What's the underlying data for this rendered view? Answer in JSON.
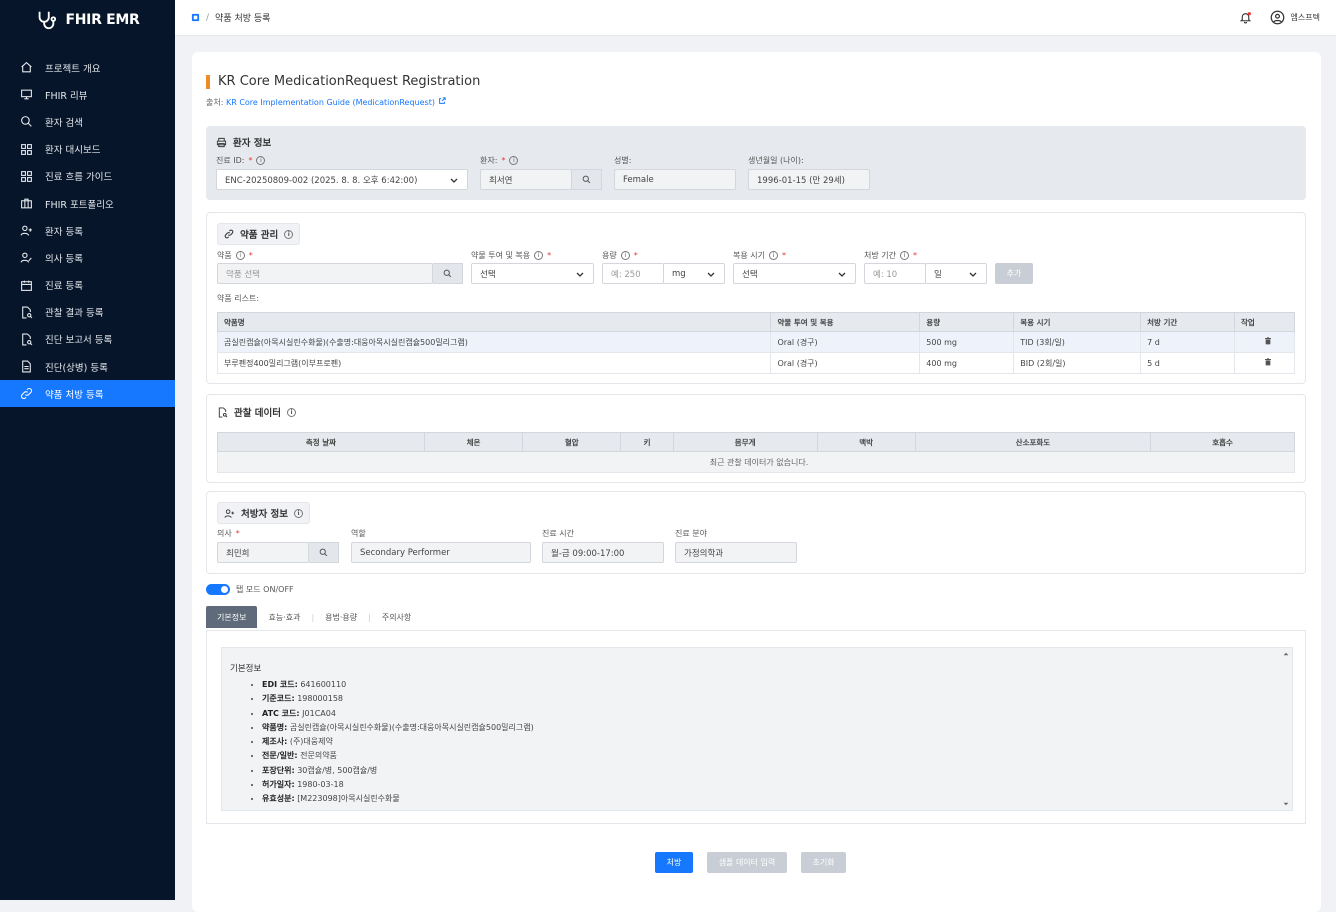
{
  "app": {
    "name": "FHIR EMR"
  },
  "sidebar": {
    "items": [
      {
        "label": "프로젝트 개요",
        "icon": "home-icon"
      },
      {
        "label": "FHIR 리뷰",
        "icon": "presentation-icon"
      },
      {
        "label": "환자 검색",
        "icon": "search-icon"
      },
      {
        "label": "환자 대시보드",
        "icon": "dashboard-icon"
      },
      {
        "label": "진료 흐름 가이드",
        "icon": "dashboard-icon"
      },
      {
        "label": "FHIR 포트폴리오",
        "icon": "portfolio-icon"
      },
      {
        "label": "환자 등록",
        "icon": "user-add-icon"
      },
      {
        "label": "의사 등록",
        "icon": "user-edit-icon"
      },
      {
        "label": "진료 등록",
        "icon": "calendar-icon"
      },
      {
        "label": "관찰 결과 등록",
        "icon": "file-search-icon"
      },
      {
        "label": "진단 보고서 등록",
        "icon": "file-search-icon"
      },
      {
        "label": "진단(상병) 등록",
        "icon": "file-text-icon"
      },
      {
        "label": "약품 처방 등록",
        "icon": "link-icon"
      }
    ],
    "active_index": 12
  },
  "topbar": {
    "breadcrumb_page": "약품 처방 등록",
    "user_name": "엠스프텍"
  },
  "page": {
    "title": "KR Core MedicationRequest Registration",
    "source_prefix": "출처: ",
    "source_link": "KR Core Implementation Guide (MedicationRequest)"
  },
  "patient": {
    "header": "환자 정보",
    "encounter_label": "진료 ID:",
    "encounter_value": "ENC-20250809-002 (2025. 8. 8. 오후 6:42:00)",
    "patient_label": "환자:",
    "patient_value": "최서연",
    "gender_label": "성별:",
    "gender_value": "Female",
    "birth_label": "생년월일 (나이):",
    "birth_value": "1996-01-15 (만 29세)"
  },
  "medication": {
    "header": "약품 관리",
    "drug_label": "약품",
    "drug_placeholder": "약품 선택",
    "route_label": "약물 투여 및 복용",
    "route_value": "선택",
    "dose_label": "용량",
    "dose_placeholder": "예: 250",
    "dose_unit": "mg",
    "timing_label": "복용 시기",
    "timing_value": "선택",
    "period_label": "처방 기간",
    "period_placeholder": "예: 10",
    "period_unit": "일",
    "add_label": "추가",
    "list_label": "약품 리스트:",
    "columns": [
      "약품명",
      "약물 투여 및 복용",
      "용량",
      "복용 시기",
      "처방 기간",
      "작업"
    ],
    "rows": [
      {
        "name": "곰실린캡슐(아목시실린수화물)(수출명:대웅아목시실린캡슐500밀리그램)",
        "route": "Oral (경구)",
        "dose": "500 mg",
        "timing": "TID (3회/일)",
        "period": "7 d"
      },
      {
        "name": "부루펜정400밀리그램(이부프로펜)",
        "route": "Oral (경구)",
        "dose": "400 mg",
        "timing": "BID (2회/일)",
        "period": "5 d"
      }
    ]
  },
  "observation": {
    "header": "관찰 데이터",
    "columns": [
      "측정 날짜",
      "체온",
      "혈압",
      "키",
      "몸무게",
      "맥박",
      "산소포화도",
      "호흡수"
    ],
    "empty_text": "최근 관찰 데이터가 없습니다."
  },
  "prescriber": {
    "header": "처방자 정보",
    "doctor_label": "의사",
    "doctor_value": "최민희",
    "role_label": "역할",
    "role_value": "Secondary Performer",
    "hours_label": "진료 시간",
    "hours_value": "월-금 09:00-17:00",
    "dept_label": "진료 분야",
    "dept_value": "가정의학과"
  },
  "tabmode": {
    "label": "탭 모드 ON/OFF",
    "on": true
  },
  "tabs": [
    "기본정보",
    "효능·효과",
    "용법·용량",
    "주의사항"
  ],
  "info": {
    "title": "기본정보",
    "items": [
      {
        "k": "EDI 코드:",
        "v": "641600110"
      },
      {
        "k": "기준코드:",
        "v": "198000158"
      },
      {
        "k": "ATC 코드:",
        "v": "J01CA04"
      },
      {
        "k": "약품명:",
        "v": "곰실린캡슐(아목시실린수화물)(수출명:대웅아목시실린캡슐500밀리그램)"
      },
      {
        "k": "제조사:",
        "v": "(주)대웅제약"
      },
      {
        "k": "전문/일반:",
        "v": "전문의약품"
      },
      {
        "k": "포장단위:",
        "v": "30캡슐/병, 500캡슐/병"
      },
      {
        "k": "허가일자:",
        "v": "1980-03-18"
      },
      {
        "k": "유효성분:",
        "v": "[M223098]아목시실린수화물"
      }
    ]
  },
  "actions": {
    "submit": "처방",
    "sample": "샘플 데이터 입력",
    "reset": "초기화"
  },
  "colors": {
    "sidebar_bg": "#061529",
    "accent": "#1677ff",
    "title_bar": "#f08a24"
  }
}
